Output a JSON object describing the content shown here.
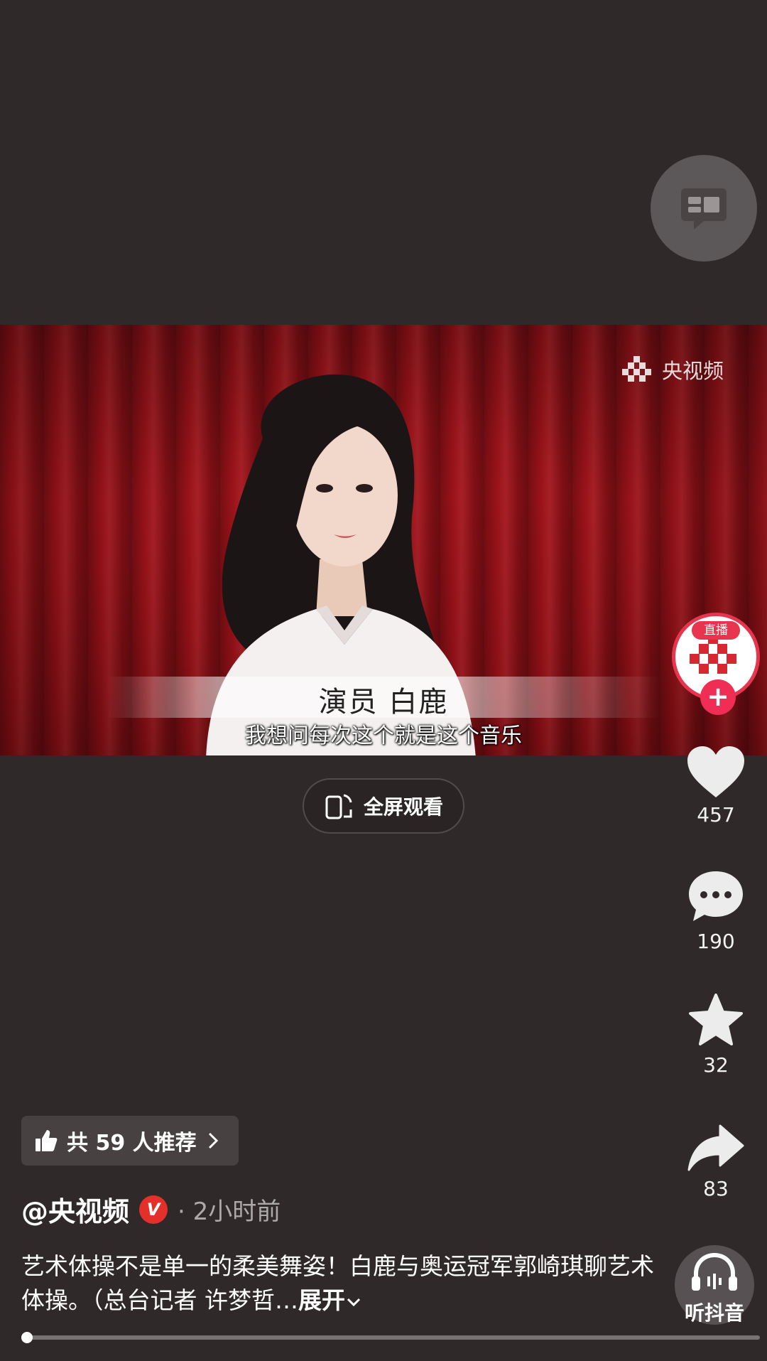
{
  "video": {
    "watermark": "央视频",
    "name_caption": "演员 白鹿",
    "subtitle": "我想问每次这个就是这个音乐"
  },
  "fullscreen": {
    "label": "全屏观看"
  },
  "avatar": {
    "live_label": "直播",
    "follow_label": "+"
  },
  "actions": {
    "likes": "457",
    "comments": "190",
    "favorites": "32",
    "shares": "83"
  },
  "listen": {
    "label": "听抖音"
  },
  "recommend": {
    "label": "共 59 人推荐"
  },
  "author": {
    "name": "@央视频",
    "verified_mark": "V",
    "time": "· 2小时前"
  },
  "caption": {
    "text": "艺术体操不是单一的柔美舞姿！白鹿与奥运冠军郭崎琪聊艺术体操。（总台记者 许梦哲…",
    "expand": "展开"
  },
  "progress": {
    "fraction": 0.005
  },
  "colors": {
    "background": "#2f292a",
    "accent": "#ef2d55",
    "verified": "#e4302b",
    "curtain": "#a3141b"
  },
  "icons": [
    "comment-bubble-icon",
    "like-heart-icon",
    "comment-icon",
    "favorite-star-icon",
    "share-icon",
    "headphones-icon",
    "fullscreen-icon",
    "thumbs-up-icon",
    "chevron-right-icon",
    "chevron-down-icon"
  ]
}
